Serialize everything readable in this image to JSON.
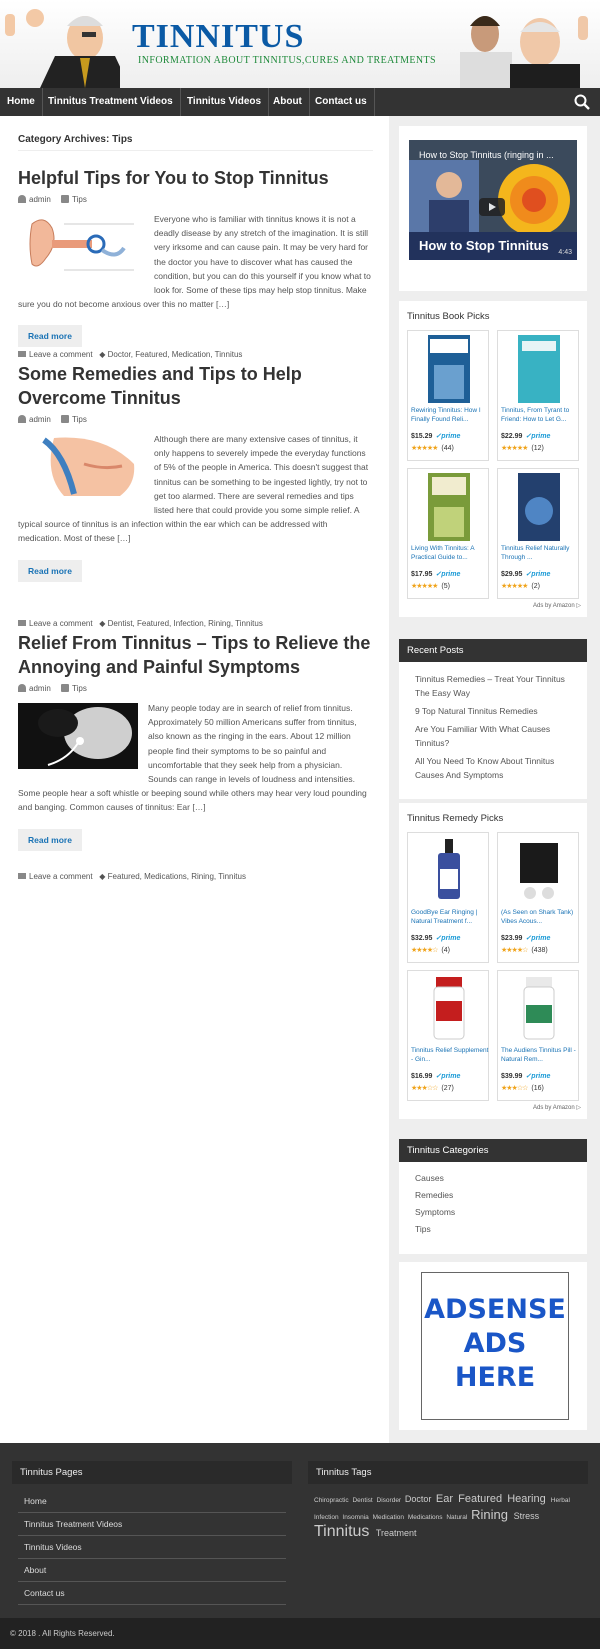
{
  "header": {
    "title": "TINNITUS",
    "tagline": "INFORMATION ABOUT TINNITUS,CURES AND TREATMENTS"
  },
  "nav": {
    "items": [
      "Home",
      "Tinnitus Treatment Videos",
      "Tinnitus Videos",
      "About",
      "Contact us"
    ],
    "search_icon": "search-icon"
  },
  "main": {
    "category_title": "Category Archives: Tips",
    "posts": [
      {
        "title": "Helpful Tips for You to Stop Tinnitus",
        "author": "admin",
        "category": "Tips",
        "excerpt": "Everyone who is familiar with tinnitus knows it is not a deadly disease by any stretch of the imagination. It is still very irksome and can cause pain. It may be very hard for the doctor you have to discover what has caused the condition, but you can do this yourself if you know what to look for. Some of these tips may help stop tinnitus. Make sure you do not become anxious over this no matter […]",
        "read_more": "Read more",
        "comment": "Leave a comment",
        "tags": "Doctor, Featured, Medication, Tinnitus"
      },
      {
        "title": "Some Remedies and Tips to Help Overcome Tinnitus",
        "author": "admin",
        "category": "Tips",
        "excerpt": "Although there are many extensive cases of tinnitus, it only happens to severely impede the everyday functions of 5% of the people in America. This doesn't suggest that tinnitus can be something to be ingested lightly, try not to get too alarmed. There are several remedies and tips listed here that could provide you some simple relief. A typical source of tinnitus is an infection within the ear which can be addressed with medication. Most of these […]",
        "read_more": "Read more",
        "comment": "Leave a comment",
        "tags": "Dentist, Featured, Infection, Rining, Tinnitus"
      },
      {
        "title": "Relief From Tinnitus – Tips to Relieve the Annoying and Painful Symptoms",
        "author": "admin",
        "category": "Tips",
        "excerpt": "Many people today are in search of relief from tinnitus. Approximately 50 million Americans suffer from tinnitus, also known as the ringing in the ears. About 12 million people find their symptoms to be so painful and uncomfortable that they seek help from a physician. Sounds can range in levels of loudness and intensities. Some people hear a soft whistle or beeping sound while others may hear very loud pounding and banging. Common causes of tinnitus: Ear […]",
        "read_more": "Read more",
        "comment": "Leave a comment",
        "tags": "Featured, Medications, Rining, Tinnitus"
      }
    ]
  },
  "sidebar": {
    "video": {
      "title": "How to Stop Tinnitus (ringing in ...",
      "banner": "How to Stop Tinnitus",
      "duration": "4:43"
    },
    "book_picks": {
      "title": "Tinnitus Book Picks",
      "products": [
        {
          "name": "Rewiring Tinnitus: How I Finally Found Reli...",
          "price": "$15.29",
          "stars": "★★★★★",
          "reviews": "(44)",
          "prime": "✓prime"
        },
        {
          "name": "Tinnitus, From Tyrant to Friend: How to Let G...",
          "price": "$22.99",
          "stars": "★★★★★",
          "reviews": "(12)",
          "prime": "✓prime"
        },
        {
          "name": "Living With Tinnitus: A Practical Guide to...",
          "price": "$17.95",
          "stars": "★★★★★",
          "reviews": "(5)",
          "prime": "✓prime"
        },
        {
          "name": "Tinnitus Relief Naturally Through ...",
          "price": "$29.95",
          "stars": "★★★★★",
          "reviews": "(2)",
          "prime": "✓prime"
        }
      ],
      "ads_by": "Ads by Amazon ▷"
    },
    "recent_posts": {
      "title": "Recent Posts",
      "items": [
        "Tinnitus Remedies – Treat Your Tinnitus The Easy Way",
        "9 Top Natural Tinnitus Remedies",
        "Are You Familiar With What Causes Tinnitus?",
        "All You Need To Know About Tinnitus Causes And Symptoms"
      ]
    },
    "remedy_picks": {
      "title": "Tinnitus Remedy Picks",
      "products": [
        {
          "name": "GoodBye Ear Ringing | Natural Treatment f...",
          "price": "$32.95",
          "stars": "★★★★☆",
          "reviews": "(4)",
          "prime": "✓prime"
        },
        {
          "name": "(As Seen on Shark Tank) Vibes Acous...",
          "price": "$23.99",
          "stars": "★★★★☆",
          "reviews": "(438)",
          "prime": "✓prime"
        },
        {
          "name": "Tinnitus Relief Supplement - Gin...",
          "price": "$16.99",
          "stars": "★★★☆☆",
          "reviews": "(27)",
          "prime": "✓prime"
        },
        {
          "name": "The Audiens Tinnitus Pill - Natural Rem...",
          "price": "$39.99",
          "stars": "★★★☆☆",
          "reviews": "(16)",
          "prime": "✓prime"
        }
      ],
      "ads_by": "Ads by Amazon ▷"
    },
    "categories": {
      "title": "Tinnitus Categories",
      "items": [
        "Causes",
        "Remedies",
        "Symptoms",
        "Tips"
      ]
    },
    "adsense": {
      "line1": "ADSENSE",
      "line2": "ADS",
      "line3": "HERE"
    }
  },
  "footer": {
    "pages": {
      "title": "Tinnitus Pages",
      "links": [
        "Home",
        "Tinnitus Treatment Videos",
        "Tinnitus Videos",
        "About",
        "Contact us"
      ]
    },
    "tags": {
      "title": "Tinnitus Tags",
      "items": [
        {
          "label": "Chiropractic",
          "size": "s"
        },
        {
          "label": "Dentist",
          "size": "s"
        },
        {
          "label": "Disorder",
          "size": "s"
        },
        {
          "label": "Doctor",
          "size": "m"
        },
        {
          "label": "Ear",
          "size": "l"
        },
        {
          "label": "Featured",
          "size": "l"
        },
        {
          "label": "Hearing",
          "size": "l"
        },
        {
          "label": "Herbal",
          "size": "s"
        },
        {
          "label": "Infection",
          "size": "s"
        },
        {
          "label": "Insomnia",
          "size": "s"
        },
        {
          "label": "Medication",
          "size": "s"
        },
        {
          "label": "Medications",
          "size": "s"
        },
        {
          "label": "Natural",
          "size": "s"
        },
        {
          "label": "Rining",
          "size": "xl"
        },
        {
          "label": "Stress",
          "size": "m"
        },
        {
          "label": "Tinnitus",
          "size": "xxl"
        },
        {
          "label": "Treatment",
          "size": "m"
        }
      ]
    },
    "copyright": "© 2018 . All Rights Reserved."
  }
}
